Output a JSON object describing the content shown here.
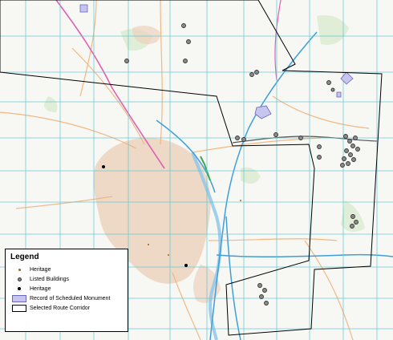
{
  "legend": {
    "title": "Legend",
    "items": [
      {
        "label": "Heritage",
        "symbol": "small-orange-dot"
      },
      {
        "label": "Listed Buildings",
        "symbol": "grey-ring"
      },
      {
        "label": "Heritage",
        "symbol": "black-dot"
      },
      {
        "label": "Record of Scheduled Monument",
        "symbol": "lavender-box"
      },
      {
        "label": "Selected Route Corridor",
        "symbol": "outlined-box"
      }
    ]
  },
  "colors": {
    "grid": "#5cc6d6",
    "corridor": "#000000",
    "scheduled_monument_fill": "#c8c4f0",
    "scheduled_monument_stroke": "#6a67b4",
    "railway": "#3f9ed8",
    "river": "#8fc8ea",
    "motorway": "#e060b0",
    "urban": "#e8c8b0",
    "road": "#f1b27a"
  }
}
